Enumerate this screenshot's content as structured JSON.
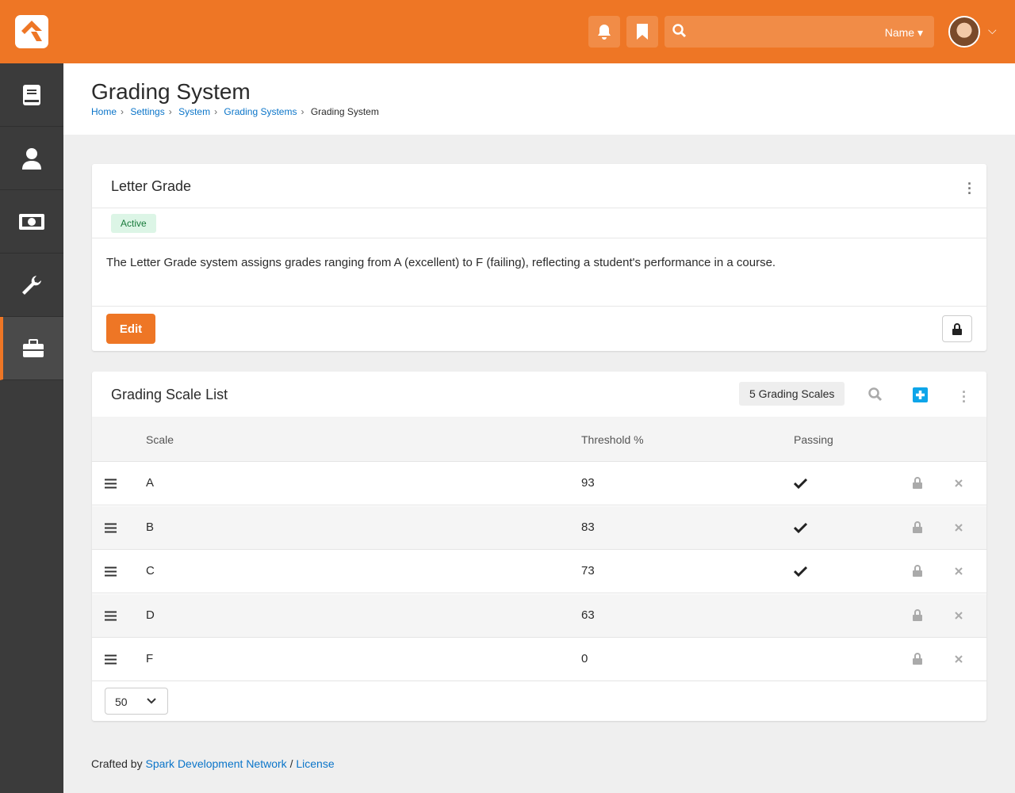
{
  "header": {
    "search_placeholder": "",
    "search_scope": "Name",
    "icons": [
      "bell-icon",
      "bookmark-icon",
      "search-icon"
    ]
  },
  "colors": {
    "brand": "#ee7625",
    "link": "#0b75c9",
    "add": "#0ea5e9"
  },
  "sidebar": {
    "items": [
      {
        "icon": "book-icon"
      },
      {
        "icon": "person-icon"
      },
      {
        "icon": "money-icon"
      },
      {
        "icon": "wrench-icon"
      },
      {
        "icon": "briefcase-icon",
        "active": true
      }
    ]
  },
  "page": {
    "title": "Grading System",
    "breadcrumb": [
      "Home",
      "Settings",
      "System",
      "Grading Systems",
      "Grading System"
    ]
  },
  "detail": {
    "title": "Letter Grade",
    "status": "Active",
    "description": "The Letter Grade system assigns grades ranging from A (excellent) to F (failing), reflecting a student's performance in a course.",
    "edit_label": "Edit"
  },
  "list": {
    "title": "Grading Scale List",
    "count": "5 Grading Scales",
    "columns": [
      "Scale",
      "Threshold %",
      "Passing"
    ],
    "rows": [
      {
        "scale": "A",
        "threshold": "93",
        "passing": true
      },
      {
        "scale": "B",
        "threshold": "83",
        "passing": true
      },
      {
        "scale": "C",
        "threshold": "73",
        "passing": true
      },
      {
        "scale": "D",
        "threshold": "63",
        "passing": false
      },
      {
        "scale": "F",
        "threshold": "0",
        "passing": false
      }
    ],
    "page_size": "50"
  },
  "footer": {
    "prefix": "Crafted by",
    "org": "Spark Development Network",
    "sep": "/",
    "license": "License"
  }
}
